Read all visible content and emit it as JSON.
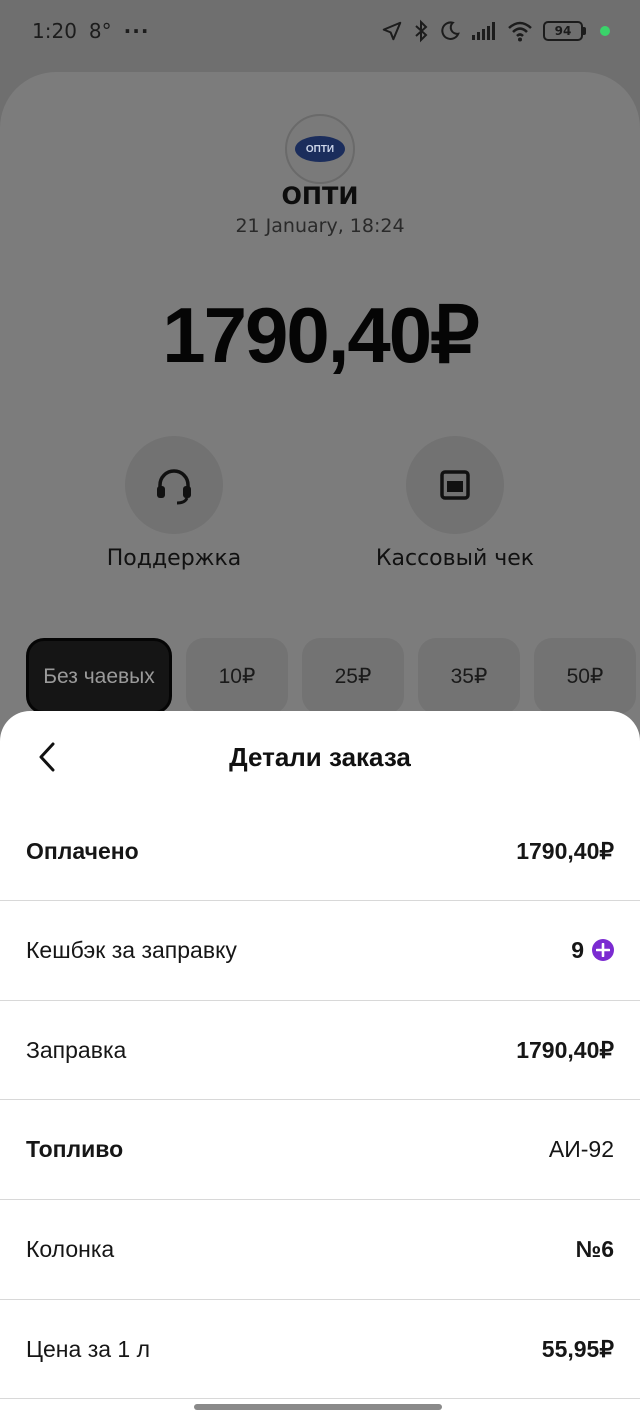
{
  "status_bar": {
    "time": "1:20",
    "temperature": "8°",
    "more": "···",
    "battery": "94",
    "icons": [
      "location-icon",
      "bluetooth-icon",
      "moon-icon",
      "signal-icon",
      "wifi-icon",
      "battery-icon"
    ]
  },
  "station": {
    "logo_text": "ОПТИ",
    "name": "ОПТИ",
    "date": "21 January, 18:24"
  },
  "amount": "1790,40₽",
  "actions": {
    "support_label": "Поддержка",
    "receipt_label": "Кассовый чек"
  },
  "tips": {
    "selected": "Без чаевых",
    "options": [
      "10₽",
      "25₽",
      "35₽",
      "50₽"
    ]
  },
  "sheet": {
    "title": "Детали заказа",
    "rows": [
      {
        "label": "Оплачено",
        "value": "1790,40₽"
      },
      {
        "label": "Кешбэк за заправку",
        "value": "9"
      },
      {
        "label": "Заправка",
        "value": "1790,40₽"
      },
      {
        "label": "Топливо",
        "value": "АИ-92"
      },
      {
        "label": "Колонка",
        "value": "№6"
      },
      {
        "label": "Цена за 1 л",
        "value": "55,95₽"
      }
    ]
  },
  "colors": {
    "cashback_accent": "#7b2bd1",
    "overlay_background": "#7c7c7c",
    "sheet_background": "#ffffff"
  }
}
